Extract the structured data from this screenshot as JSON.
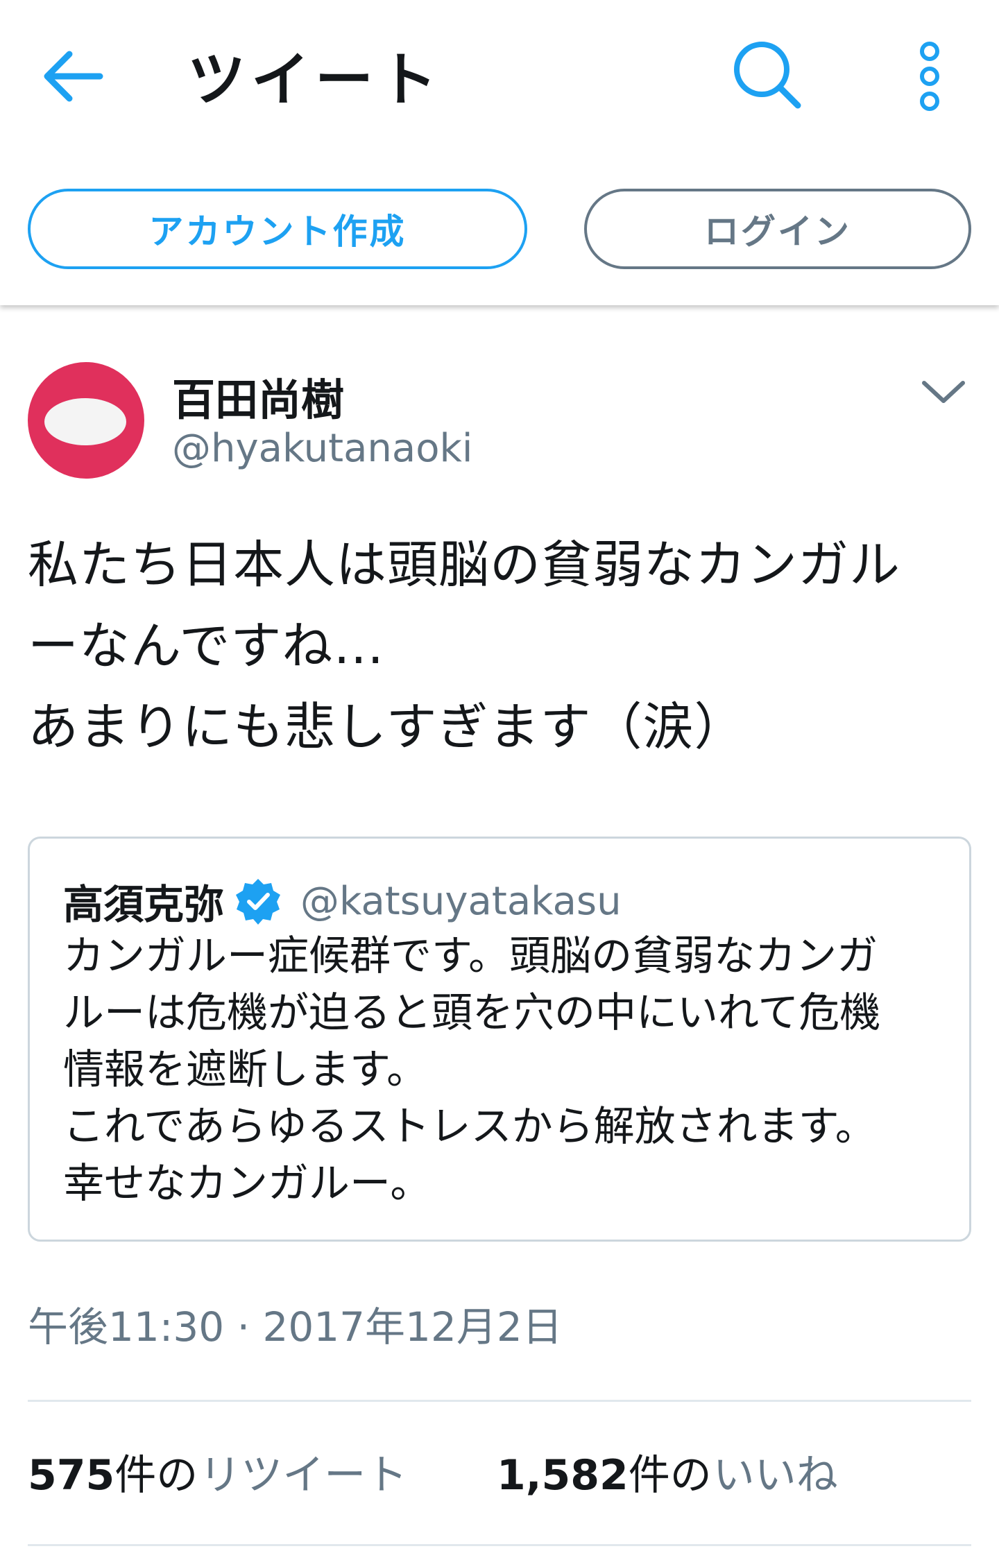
{
  "header": {
    "title": "ツイート",
    "signup_label": "アカウント作成",
    "login_label": "ログイン",
    "accent_color": "#1da1f2",
    "icons": [
      "back-arrow-icon",
      "search-icon",
      "more-vertical-icon"
    ]
  },
  "tweet": {
    "author_name": "百田尚樹",
    "author_handle": "@hyakutanaoki",
    "avatar_color": "#e0305c",
    "text": "私たち日本人は頭脳の貧弱なカンガル\nーなんですね…\nあまりにも悲しすぎます（涙）",
    "quoted": {
      "author_name": "高須克弥",
      "author_handle": "@katsuyatakasu",
      "verified": true,
      "text": "カンガルー症候群です。頭脳の貧弱なカンガ\nルーは危機が迫ると頭を穴の中にいれて危機\n情報を遮断します。\nこれであらゆるストレスから解放されます。\n幸せなカンガルー。"
    },
    "timestamp": "午後11:30 · 2017年12月2日",
    "retweets": {
      "count": "575",
      "unit": "件の",
      "label": "リツイート"
    },
    "likes": {
      "count": "1,582",
      "unit": "件の",
      "label": "いいね"
    }
  }
}
